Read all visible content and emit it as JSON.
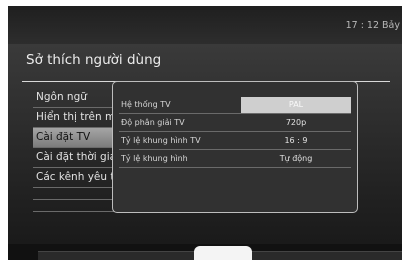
{
  "header": {
    "clock": "17 : 12  Bảy"
  },
  "page": {
    "title": "Sở thích người dùng"
  },
  "menu": {
    "items": [
      {
        "label": "Ngôn ngữ"
      },
      {
        "label": "Hiển thị trên màn hình"
      },
      {
        "label": "Cài đặt TV"
      },
      {
        "label": "Cài đặt thời gian"
      },
      {
        "label": "Các kênh yêu thích"
      }
    ],
    "selected_index": 2
  },
  "tv_settings": {
    "rows": [
      {
        "label": "Hệ thống TV",
        "value": "PAL"
      },
      {
        "label": "Độ phân giải TV",
        "value": "720p"
      },
      {
        "label": "Tỷ lệ khung hình TV",
        "value": "16 : 9"
      },
      {
        "label": "Tỷ lệ khung hình",
        "value": "Tự động"
      }
    ],
    "active_index": 0
  }
}
